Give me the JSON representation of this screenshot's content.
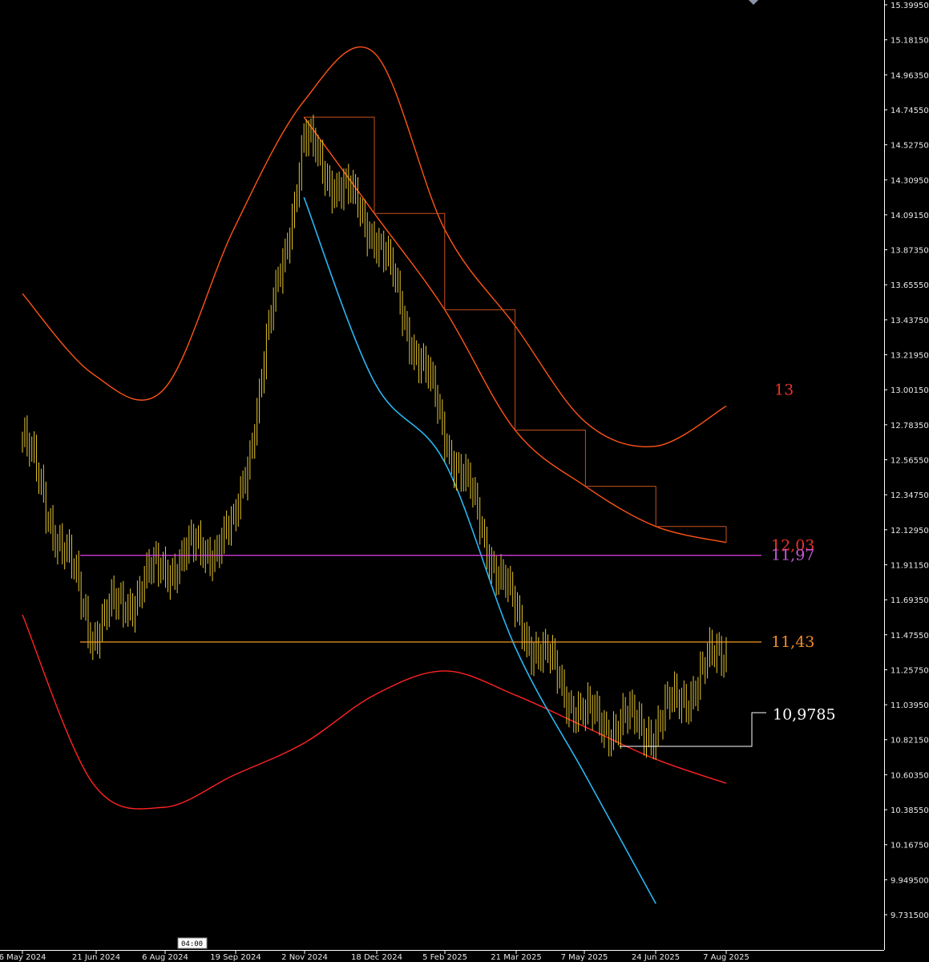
{
  "chart_data": {
    "type": "line",
    "title": "",
    "xlabel": "",
    "ylabel": "",
    "ylim": [
      9.62,
      15.44
    ],
    "grid": false,
    "background": "#000000",
    "x_tick_labels": [
      "6 May 2024",
      "21 Jun 2024",
      "6 Aug 2024",
      "19 Sep 2024",
      "2 Nov 2024",
      "18 Dec 2024",
      "5 Feb 2025",
      "21 Mar 2025",
      "7 May 2025",
      "24 Jun 2025",
      "7 Aug 2025"
    ],
    "y_tick_labels": [
      "15.399500",
      "15.181500",
      "14.963500",
      "14.745500",
      "14.527500",
      "14.309500",
      "14.091500",
      "13.873500",
      "13.655500",
      "13.437500",
      "13.219500",
      "13.001500",
      "12.783500",
      "12.565500",
      "12.347500",
      "12.129500",
      "11.911500",
      "11.693500",
      "11.475500",
      "11.257500",
      "11.039500",
      "10.821500",
      "10.603500",
      "10.385500",
      "10.167500",
      "9.949500",
      "9.731500"
    ],
    "x": [
      "6 May 2024",
      "21 Jun 2024",
      "6 Aug 2024",
      "19 Sep 2024",
      "2 Nov 2024",
      "18 Dec 2024",
      "5 Feb 2025",
      "21 Mar 2025",
      "7 May 2025",
      "24 Jun 2025",
      "7 Aug 2025"
    ],
    "series": [
      {
        "role": "price",
        "color": "#e6c62e",
        "values": [
          12.7,
          11.5,
          11.9,
          12.1,
          14.55,
          14.0,
          12.75,
          11.6,
          10.95,
          10.9,
          11.4
        ]
      },
      {
        "role": "upper-band",
        "color": "#ff5418",
        "values": [
          13.6,
          13.1,
          13.0,
          14.0,
          14.8,
          15.1,
          14.0,
          13.4,
          12.8,
          12.65,
          12.9
        ]
      },
      {
        "role": "middle-band",
        "color": "#ff5418",
        "values": [
          null,
          null,
          null,
          null,
          14.7,
          14.1,
          13.5,
          12.75,
          12.4,
          12.15,
          12.05
        ]
      },
      {
        "role": "lower-band",
        "color": "#ff2222",
        "values": [
          11.6,
          10.55,
          10.4,
          10.6,
          10.8,
          11.1,
          11.25,
          11.1,
          10.9,
          10.7,
          10.55
        ]
      },
      {
        "role": "trailing-stop",
        "color": "#28b6f0",
        "values": [
          null,
          null,
          null,
          null,
          14.2,
          13.05,
          12.55,
          11.4,
          10.6,
          9.8,
          null
        ]
      }
    ],
    "horizontal_levels": [
      {
        "value": 11.97,
        "label": "11,97",
        "color": "#e040e8"
      },
      {
        "value": 11.43,
        "label": "11,43",
        "color": "#f39a24"
      }
    ],
    "annotations": [
      {
        "text": "13",
        "value": 13.0,
        "color": "#e8332a"
      },
      {
        "text": "12,03",
        "value": 12.03,
        "color": "#e8332a"
      },
      {
        "text": "11,97",
        "value": 11.97,
        "color": "#c15ad6"
      },
      {
        "text": "11,43",
        "value": 11.43,
        "color": "#f08a2a"
      },
      {
        "text": "10,9785",
        "value": 10.9785,
        "color": "#ffffff"
      }
    ],
    "countdown_label": "04:00",
    "axis_color": "#ffffff"
  }
}
